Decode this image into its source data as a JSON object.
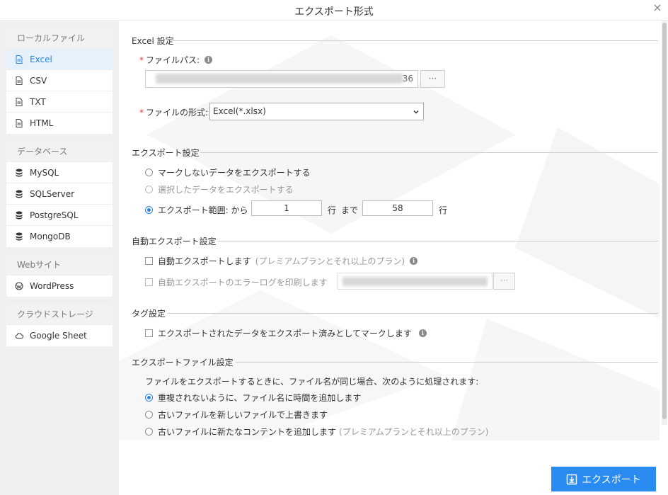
{
  "window": {
    "title": "エクスポート形式",
    "close_label": "×"
  },
  "sidebar": {
    "groups": [
      {
        "header": "ローカルファイル",
        "items": [
          {
            "label": "Excel",
            "icon": "file-icon",
            "active": true
          },
          {
            "label": "CSV",
            "icon": "file-icon"
          },
          {
            "label": "TXT",
            "icon": "file-icon"
          },
          {
            "label": "HTML",
            "icon": "file-icon"
          }
        ]
      },
      {
        "header": "データベース",
        "items": [
          {
            "label": "MySQL",
            "icon": "database-icon"
          },
          {
            "label": "SQLServer",
            "icon": "database-icon"
          },
          {
            "label": "PostgreSQL",
            "icon": "database-icon"
          },
          {
            "label": "MongoDB",
            "icon": "database-icon"
          }
        ]
      },
      {
        "header": "Webサイト",
        "items": [
          {
            "label": "WordPress",
            "icon": "wordpress-icon"
          }
        ]
      },
      {
        "header": "クラウドストレージ",
        "items": [
          {
            "label": "Google Sheet",
            "icon": "cloud-icon"
          }
        ]
      }
    ]
  },
  "excel_settings": {
    "title": "Excel 設定",
    "file_path_label": "ファイルパス:",
    "file_path_value_suffix": "36",
    "browse_label": "···",
    "file_format_label": "ファイルの形式:",
    "file_format_value": "Excel(*.xlsx)"
  },
  "export_settings": {
    "title": "エクスポート設定",
    "option_unmarked": "マークしないデータをエクスポートする",
    "option_selected": "選択したデータをエクスポートする",
    "option_range": "エクスポート範囲: から",
    "range_from": "1",
    "row_label": "行",
    "to_label": "まで",
    "range_to": "58",
    "row_label2": "行"
  },
  "auto_export": {
    "title": "自動エクスポート設定",
    "auto_export_label": "自動エクスポートします",
    "premium_note": "(プレミアムプランとそれ以上のプラン)",
    "error_log_label": "自動エクスポートのエラーログを印刷します",
    "browse_label": "···"
  },
  "tag_settings": {
    "title": "タグ設定",
    "mark_exported_label": "エクスポートされたデータをエクスポート済みとしてマークします"
  },
  "file_settings": {
    "title": "エクスポートファイル設定",
    "description": "ファイルをエクスポートするときに、ファイル名が同じ場合、次のように処理されます:",
    "option_add_time": "重複されないように、ファイル名に時間を追加します",
    "option_overwrite": "古いファイルを新しいファイルで上書きます",
    "option_append": "古いファイルに新たなコンテントを追加します",
    "append_premium_note": "(プレミアムプランとそれ以上のプラン)"
  },
  "footer": {
    "export_button_label": "エクスポート"
  },
  "colors": {
    "accent": "#2a8cf0",
    "required": "#e4393c",
    "active_bg": "#e5f1fb"
  }
}
